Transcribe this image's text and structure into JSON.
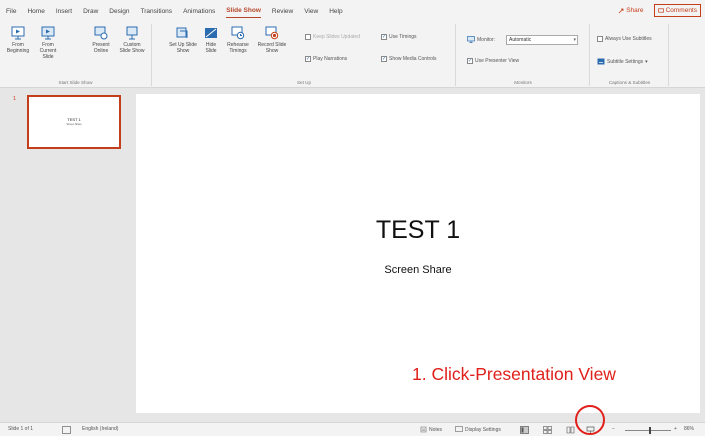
{
  "menu": {
    "tabs": [
      "File",
      "Home",
      "Insert",
      "Draw",
      "Design",
      "Transitions",
      "Animations",
      "Slide Show",
      "Review",
      "View",
      "Help"
    ],
    "active_tab": "Slide Show",
    "share_label": "Share",
    "comments_label": "Comments"
  },
  "ribbon": {
    "start_group": {
      "label": "Start Slide Show",
      "from_beginning": "From Beginning",
      "from_current": "From Current Slide",
      "present_online": "Present Online",
      "custom_show": "Custom Slide Show"
    },
    "setup_group": {
      "label": "Set Up",
      "setup_show": "Set Up Slide Show",
      "hide_slide": "Hide Slide",
      "rehearse": "Rehearse Timings",
      "record": "Record Slide Show",
      "keep_updated": "Keep Slides Updated",
      "play_narrations": "Play Narrations",
      "use_timings": "Use Timings",
      "show_media": "Show Media Controls"
    },
    "monitors_group": {
      "label": "Monitors",
      "monitor_label": "Monitor:",
      "monitor_value": "Automatic",
      "presenter_view": "Use Presenter View"
    },
    "captions_group": {
      "label": "Captions & Subtitles",
      "always_subtitles": "Always Use Subtitles",
      "subtitle_settings": "Subtitle Settings"
    }
  },
  "thumbnails": {
    "number": "1",
    "title": "TEST 1",
    "subtitle": "Screen Share"
  },
  "slide": {
    "title": "TEST 1",
    "subtitle": "Screen Share"
  },
  "annotation": {
    "callout": "1. Click-Presentation View"
  },
  "status": {
    "slide_count": "Slide 1 of 1",
    "language": "English (Ireland)",
    "notes": "Notes",
    "display_settings": "Display Settings",
    "zoom": "86%"
  },
  "colors": {
    "accent": "#c43e1c",
    "annotation": "#e0201b"
  }
}
